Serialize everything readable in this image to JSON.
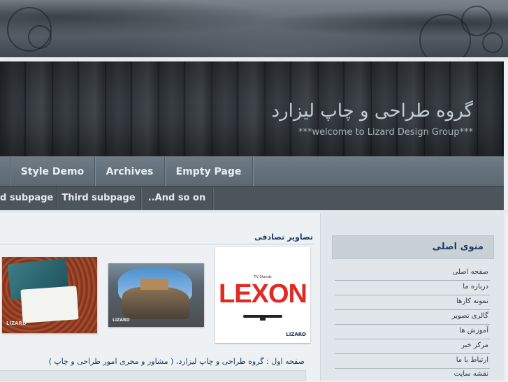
{
  "header": {
    "title": "گروه طراحی و چاپ لیزارد",
    "subtitle": "***welcome to Lizard Design Group***"
  },
  "main_nav": [
    {
      "label": "Style Demo"
    },
    {
      "label": "Archives"
    },
    {
      "label": "Empty Page"
    }
  ],
  "sub_nav": [
    {
      "label": "d subpage"
    },
    {
      "label": "Third subpage"
    },
    {
      "label": "..And so on"
    }
  ],
  "content": {
    "random_images_title": "تصاویر تصادفی",
    "intro_text": "صفحه اول : گروه طراحی و چاپ لیزارد، ( مشاور و مجری امور طراحی و چاپ )",
    "images": [
      {
        "name": "lexon-tv-stands",
        "top_text": "TV Stands",
        "brand": "LEXON",
        "logo": "LIZARD"
      },
      {
        "name": "castle-rock",
        "logo": "LIZARD"
      },
      {
        "name": "business-cards",
        "logo": "LIZARD"
      }
    ]
  },
  "sidebar": {
    "title": "منوی اصلی",
    "items": [
      {
        "label": "صفحه اصلی"
      },
      {
        "label": "درباره ما"
      },
      {
        "label": "نمونه کارها"
      },
      {
        "label": "گالری تصویر"
      },
      {
        "label": "آموزش ها"
      },
      {
        "label": "مرکز خبر"
      },
      {
        "label": "ارتباط با ما"
      },
      {
        "label": "نقشه سایت"
      }
    ]
  },
  "colors": {
    "accent": "#1b3d66",
    "nav": "#5b6771",
    "subnav": "#4d555c",
    "lexon_red": "#e12a24"
  }
}
